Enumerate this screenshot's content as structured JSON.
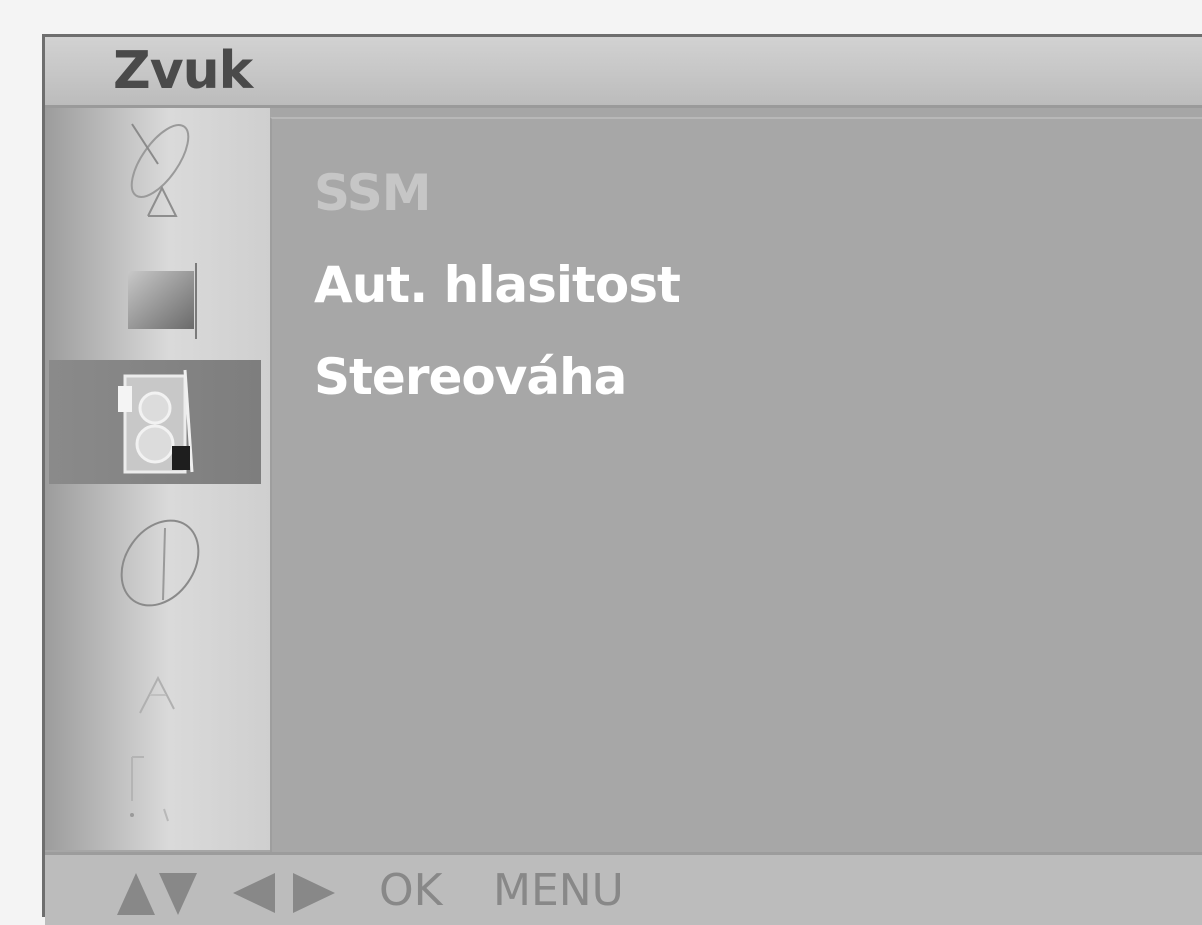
{
  "header": {
    "title": "Zvuk"
  },
  "sidebar": {
    "items": [
      {
        "icon": "satellite-dish-icon"
      },
      {
        "icon": "picture-icon"
      },
      {
        "icon": "speaker-icon",
        "selected": true
      },
      {
        "icon": "clock-icon"
      },
      {
        "icon": "option-icon"
      },
      {
        "icon": "screen-icon"
      }
    ]
  },
  "menu": {
    "items": [
      {
        "label": "SSM",
        "state": "disabled"
      },
      {
        "label": "Aut. hlasitost",
        "state": "enabled"
      },
      {
        "label": "Stereováha",
        "state": "enabled"
      }
    ]
  },
  "footer": {
    "up_down_icon": "up-down-arrows-icon",
    "left_right_icon": "left-right-arrows-icon",
    "ok_label": "OK",
    "menu_label": "MENU"
  },
  "colors": {
    "panel": "#a7a7a7",
    "title_text": "#4a4a4a",
    "menu_text": "#ffffff",
    "disabled_text": "#c6c6c6",
    "hint_text": "#888888"
  }
}
